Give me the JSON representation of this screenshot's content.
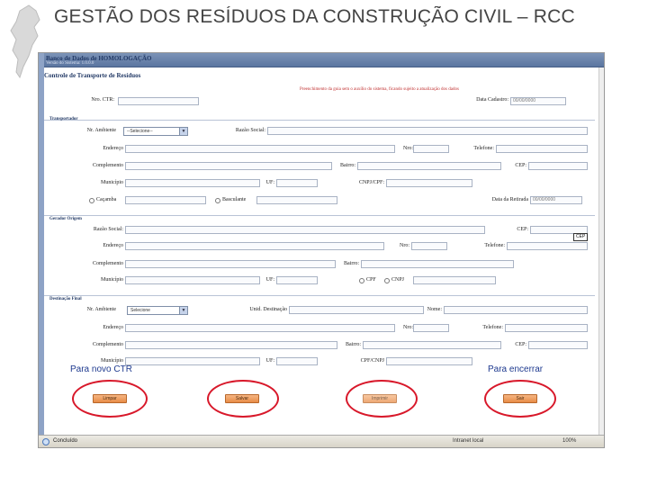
{
  "slide": {
    "title": "GESTÃO DOS RESÍDUOS DA CONSTRUÇÃO CIVIL – RCC"
  },
  "app": {
    "name": "Banco de Dados de HOMOLOGAÇÃO",
    "subtitle": "Versão do Sistema: 1.0.0.0",
    "form_title": "Controle de Transporte de Resíduos",
    "warning": "Preenchimento da guia sem o auxílio do sistema, ficando sujeito a atualização dos dados"
  },
  "header": {
    "ctr_label": "Nro. CTR:",
    "date_label": "Data Cadastro:",
    "date_value": "00/00/0000"
  },
  "transportador": {
    "title": "Transportador",
    "amb_label": "Nr. Ambiente",
    "amb_value": "--Selecione--",
    "razao_label": "Razão Social:",
    "endereco_label": "Endereço",
    "nro_label": "Nro:",
    "telefone_label": "Telefone:",
    "complemento_label": "Complemento",
    "bairro_label": "Bairro:",
    "cep_label": "CEP:",
    "municipio_label": "Município",
    "uf_label": "UF:",
    "cnpj_label": "CNPJ/CPF:",
    "radio1_label": "Caçamba",
    "radio2_label": "Basculante",
    "retirada_label": "Data da Retirada",
    "retirada_value": "00/00/0000"
  },
  "gerador": {
    "title": "Gerador Origem",
    "razao_label": "Razão Social:",
    "cep_label": "CEP:",
    "cep_button": "CEP",
    "endereco_label": "Endereço",
    "nro_label": "Nro:",
    "telefone_label": "Telefone:",
    "complemento_label": "Complemento",
    "bairro_label": "Bairro:",
    "municipio_label": "Município",
    "uf_label": "UF:",
    "cpf_label": "CPF",
    "cnpj_label": "CNPJ"
  },
  "destinacao": {
    "title": "Destinação Final",
    "amb_label": "Nr. Ambiente",
    "amb_value": "Selecione",
    "unid_label": "Unid. Destinação",
    "nome_label": "Nome:",
    "endereco_label": "Endereço",
    "nro_label": "Nro:",
    "telefone_label": "Telefone:",
    "complemento_label": "Complemento",
    "bairro_label": "Bairro:",
    "cep_label": "CEP:",
    "municipio_label": "Município",
    "uf_label": "UF:",
    "cnpj_label": "CPF/CNPJ"
  },
  "buttons": {
    "limpar": "Limpar",
    "salvar": "Salvar",
    "imprimir": "Imprimir",
    "sair": "Sair"
  },
  "annotations": {
    "novo_ctr": "Para novo CTR",
    "encerrar": "Para encerrar"
  },
  "status": {
    "text": "Concluído",
    "zone": "Intranet local",
    "zoom": "100%"
  },
  "colors": {
    "ring": "#d8182a",
    "note": "#1e3a8f",
    "button": "#e88c47"
  }
}
